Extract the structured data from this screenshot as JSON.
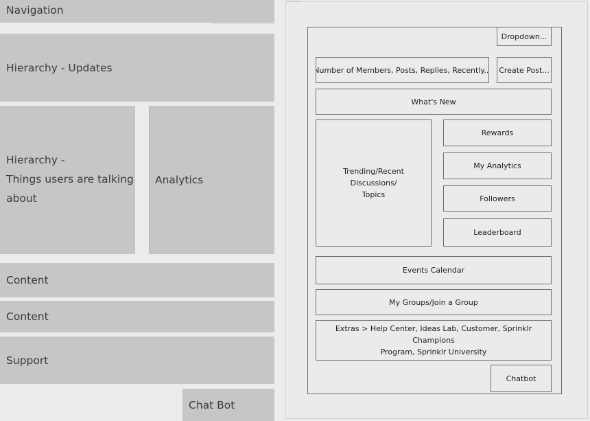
{
  "left": {
    "navigation": "Navigation",
    "hierarchy_updates": "Hierarchy - Updates",
    "hierarchy_talking": [
      "Hierarchy -",
      "Things users are talking",
      "about"
    ],
    "analytics": "Analytics",
    "content_1": "Content",
    "content_2": "Content",
    "support": "Support",
    "chat_bot": "Chat Bot"
  },
  "right": {
    "dropdown": "Dropdown...",
    "stats": "Number of Members, Posts, Replies, Recently...",
    "create_post": "Create Post...",
    "whats_new": "What's New",
    "trending": [
      "Trending/Recent Discussions/",
      "Topics"
    ],
    "rewards": "Rewards",
    "my_analytics": "My Analytics",
    "followers": "Followers",
    "leaderboard": "Leaderboard",
    "events_calendar": "Events Calendar",
    "my_groups": "My Groups/Join a Group",
    "extras": [
      "Extras > Help Center, Ideas Lab, Customer, Sprinklr Champions",
      "Program, Sprinklr University"
    ],
    "chatbot": "Chatbot"
  }
}
